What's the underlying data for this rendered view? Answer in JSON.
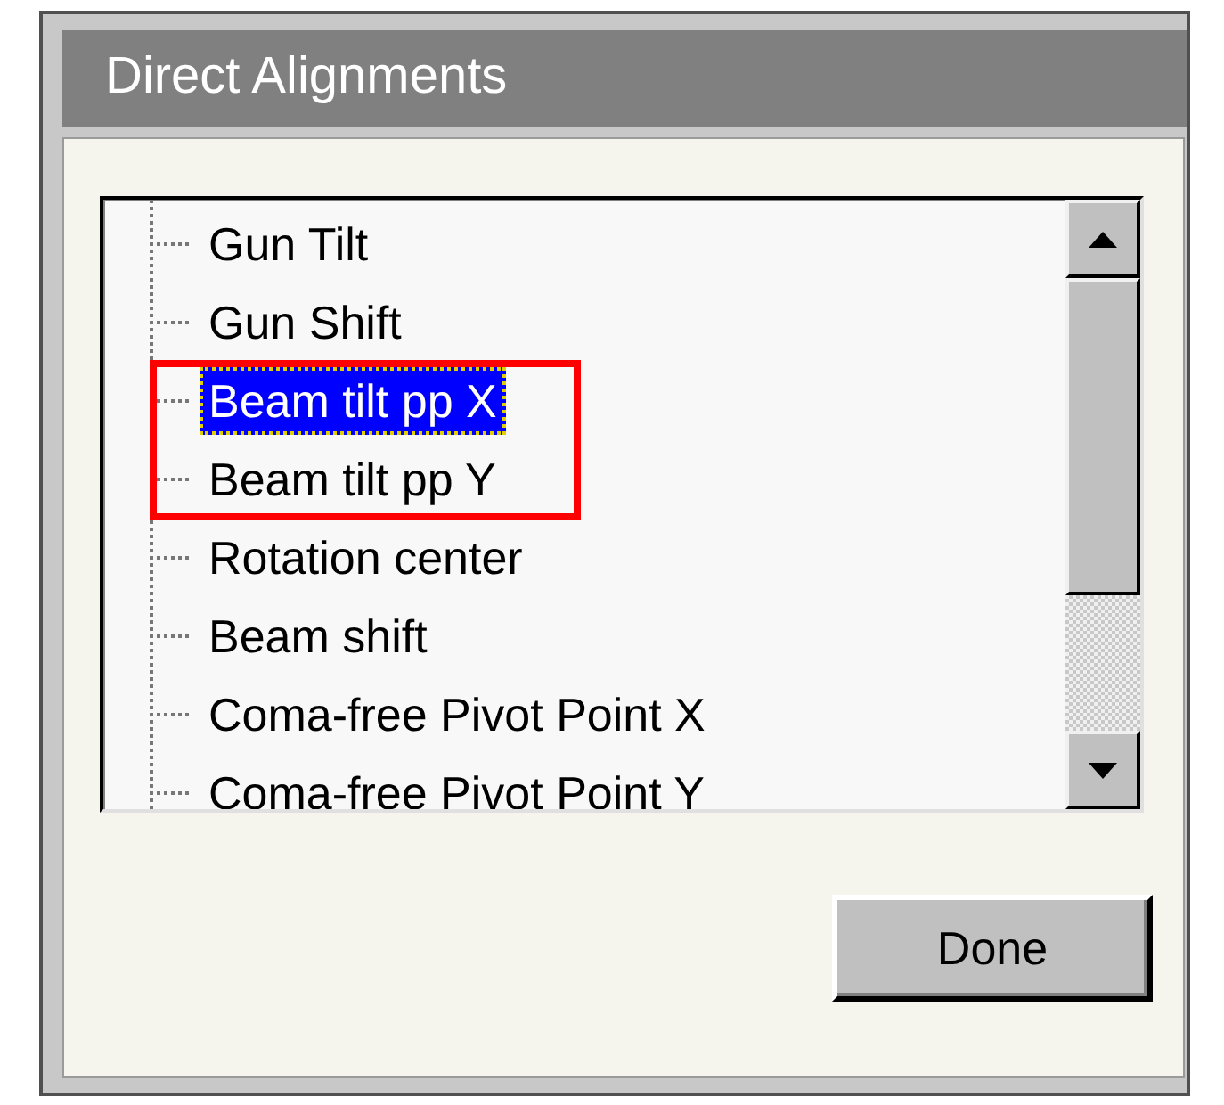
{
  "window": {
    "title": "Direct Alignments"
  },
  "list": {
    "items": [
      {
        "label": "Gun Tilt",
        "selected": false,
        "highlighted": false
      },
      {
        "label": "Gun Shift",
        "selected": false,
        "highlighted": false
      },
      {
        "label": "Beam tilt pp X",
        "selected": true,
        "highlighted": true
      },
      {
        "label": "Beam tilt pp Y",
        "selected": false,
        "highlighted": true
      },
      {
        "label": "Rotation center",
        "selected": false,
        "highlighted": false
      },
      {
        "label": "Beam shift",
        "selected": false,
        "highlighted": false
      },
      {
        "label": "Coma-free Pivot Point X",
        "selected": false,
        "highlighted": false
      },
      {
        "label": "Coma-free Pivot Point Y",
        "selected": false,
        "highlighted": false
      }
    ]
  },
  "buttons": [
    {
      "label": "Done"
    }
  ]
}
